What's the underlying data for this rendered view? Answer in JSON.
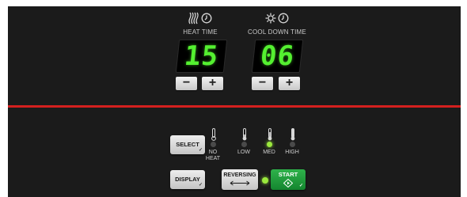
{
  "heat_timer": {
    "title": "HEAT TIME",
    "display_value": "15",
    "minus_label": "−",
    "plus_label": "+",
    "icons": [
      "heat-waves-icon",
      "clock-icon"
    ]
  },
  "cooldown_timer": {
    "title": "COOL DOWN TIME",
    "display_value": "06",
    "minus_label": "−",
    "plus_label": "+",
    "icons": [
      "cooling-fan-icon",
      "clock-icon"
    ]
  },
  "controls": {
    "select_label": "SELECT",
    "display_label": "DISPLAY",
    "reversing_label": "REVERSING",
    "start_label": "START"
  },
  "heat_levels": [
    {
      "label": "NO HEAT",
      "active": false
    },
    {
      "label": "LOW",
      "active": false
    },
    {
      "label": "MED",
      "active": true
    },
    {
      "label": "HIGH",
      "active": false
    }
  ],
  "reversing_indicator_on": true,
  "colors": {
    "panel": "#1b1b1b",
    "divider": "#d3201f",
    "digits": "#54f030",
    "led_on": "#9be93d",
    "led_off": "#4a4a4a",
    "start_button": "#1f9a3c"
  }
}
